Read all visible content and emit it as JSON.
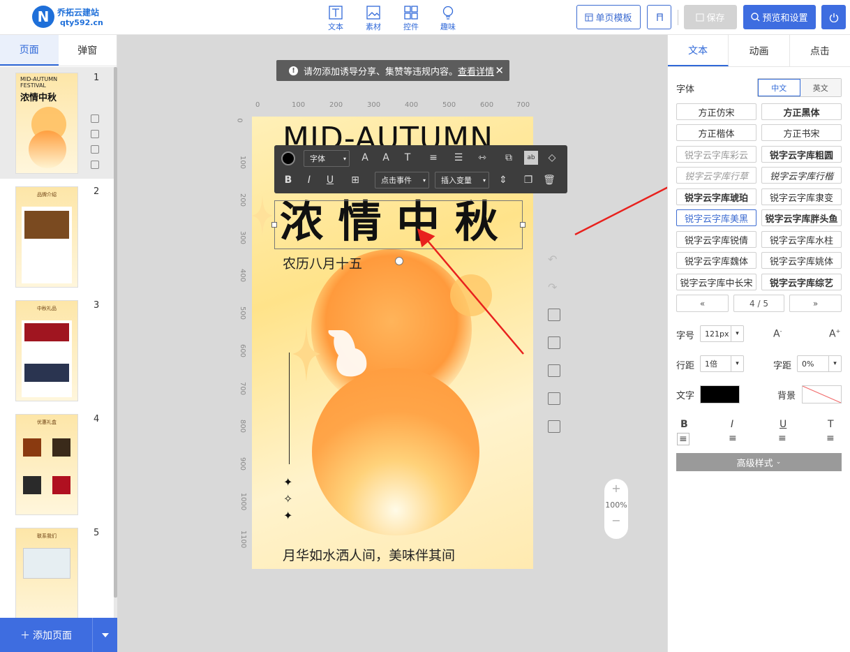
{
  "logo": {
    "mark": "N",
    "title": "乔拓云建站",
    "domain": "qty592.cn"
  },
  "toolbar_top": {
    "tools": [
      {
        "label": "文本",
        "icon": "text-icon"
      },
      {
        "label": "素材",
        "icon": "image-icon"
      },
      {
        "label": "控件",
        "icon": "widgets-icon"
      },
      {
        "label": "趣味",
        "icon": "lightbulb-icon"
      }
    ],
    "single_template": "单页模板",
    "save": "保存",
    "preview": "预览和设置"
  },
  "left_panel": {
    "tabs": [
      "页面",
      "弹窗"
    ],
    "pages": [
      {
        "num": "1",
        "title_en": "MID-AUTUMN FESTIVAL",
        "title_cn": "浓情中秋"
      },
      {
        "num": "2",
        "title_cn": "品牌介绍"
      },
      {
        "num": "3",
        "title_cn": "中秋礼品"
      },
      {
        "num": "4",
        "title_cn": "优惠礼盒"
      },
      {
        "num": "5",
        "title_cn": "联系我们"
      }
    ],
    "add_page": "添加页面"
  },
  "notice": {
    "text": "请勿添加诱导分享、集赞等违规内容。",
    "link": "查看详情"
  },
  "ruler": {
    "h": [
      "0",
      "100",
      "200",
      "300",
      "400",
      "500",
      "600",
      "700"
    ],
    "v": [
      "0",
      "100",
      "200",
      "300",
      "400",
      "500",
      "600",
      "700",
      "800",
      "900",
      "1000",
      "1100"
    ]
  },
  "canvas": {
    "heading_en": "MID-AUTUMN",
    "heading_cn": "浓 情 中 秋",
    "subtitle": "农历八月十五",
    "footer": "月华如水洒人间，美味伴其间"
  },
  "text_toolbar": {
    "font": "字体",
    "click_event": "点击事件",
    "insert_var": "插入变量"
  },
  "zoom": {
    "value": "100%"
  },
  "right_panel": {
    "tabs": [
      "文本",
      "动画",
      "点击"
    ],
    "font_label": "字体",
    "lang": [
      "中文",
      "英文"
    ],
    "fonts": [
      "方正仿宋",
      "方正黑体",
      "方正楷体",
      "方正书宋",
      "锐字云字库彩云",
      "锐字云字库粗圆",
      "锐字云字库行草",
      "锐字云字库行楷",
      "锐字云字库琥珀",
      "锐字云字库隶变",
      "锐字云字库美黑",
      "锐字云字库胖头鱼",
      "锐字云字库锐倩",
      "锐字云字库水柱",
      "锐字云字库魏体",
      "锐字云字库姚体",
      "锐字云字库中长宋",
      "锐字云字库综艺"
    ],
    "selected_font": "锐字云字库美黑",
    "pager": {
      "prev": "«",
      "page": "4 / 5",
      "next": "»"
    },
    "size_label": "字号",
    "size_value": "121px",
    "line_label": "行距",
    "line_value": "1倍",
    "spacing_label": "字距",
    "spacing_value": "0%",
    "color_label": "文字",
    "text_color": "#000000",
    "bg_label": "背景",
    "advanced": "高级样式"
  }
}
